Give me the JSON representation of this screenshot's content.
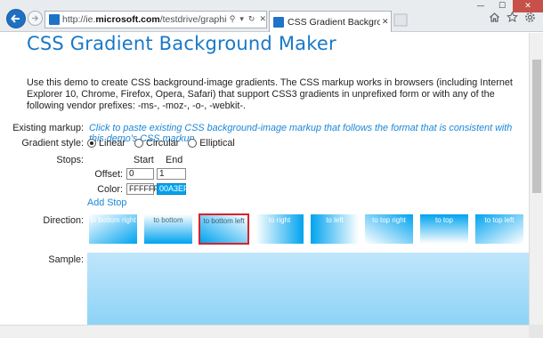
{
  "browser": {
    "url_prefix": "http://ie.",
    "url_domain": "microsoft.com",
    "url_path": "/testdrive/graphics/cssgradientb...",
    "tab_title": "CSS Gradient Background..."
  },
  "page": {
    "title": "CSS Gradient Background Maker",
    "intro": "Use this demo to create CSS background-image gradients. The CSS markup works in browsers (including Internet Explorer 10, Chrome, Firefox, Opera, Safari) that support CSS3 gradients in unprefixed form or with any of the following vendor prefixes: -ms-, -moz-, -o-, -webkit-.",
    "existing_markup_label": "Existing markup:",
    "existing_markup_link": "Click to paste existing CSS background-image markup that follows the format that is consistent with this demo's CSS markup.",
    "gradient_style_label": "Gradient style:",
    "gradient_styles": [
      "Linear",
      "Circular",
      "Elliptical"
    ],
    "selected_style": "Linear",
    "stops_label": "Stops:",
    "start_label": "Start",
    "end_label": "End",
    "offset_label": "Offset:",
    "color_label": "Color:",
    "offset_start": "0",
    "offset_end": "1",
    "color_start": "FFFFFF",
    "color_end": "00A3EF",
    "add_stop": "Add Stop",
    "direction_label": "Direction:",
    "directions": [
      "to bottom right",
      "to bottom",
      "to bottom left",
      "to right",
      "to left",
      "to top right",
      "to top",
      "to top left"
    ],
    "selected_direction": "to bottom left",
    "sample_label": "Sample:"
  },
  "colors": {
    "accent": "#1978c8",
    "link": "#1a86d8",
    "gradient_end": "#00A3EF",
    "selected_border": "#d9212a"
  }
}
